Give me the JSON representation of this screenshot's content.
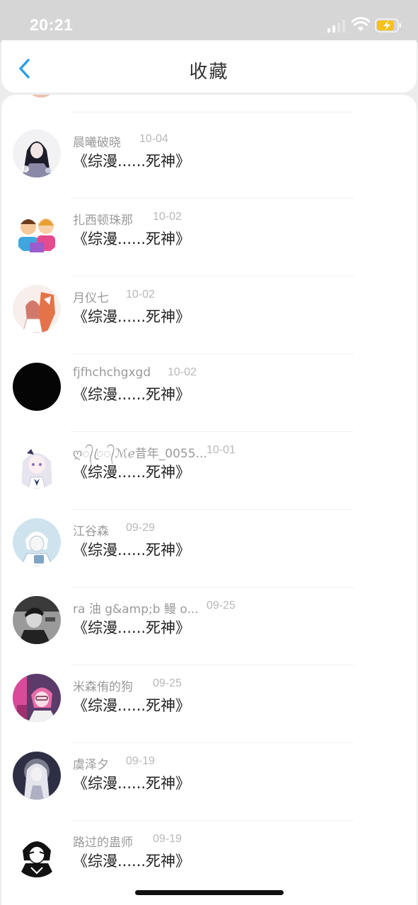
{
  "status_bar": {
    "time": "20:21",
    "signal_icon": "cellular-signal-icon",
    "wifi_icon": "wifi-icon",
    "battery_icon": "battery-charging-icon"
  },
  "header": {
    "title": "收藏",
    "back_icon": "chevron-left-icon"
  },
  "colors": {
    "accent": "#2b9fe6",
    "battery": "#f5c21b",
    "username": "#9a9a9a",
    "date": "#b8b8b8",
    "title": "#222222"
  },
  "favorites": [
    {
      "username": "晨曦破晓",
      "date": "10-04",
      "title": "《综漫......死神》",
      "avatar": "anime-dark-hair-avatar"
    },
    {
      "username": "扎西顿珠那",
      "date": "10-02",
      "title": "《综漫......死神》",
      "avatar": "cartoon-kids-avatar"
    },
    {
      "username": "月仪七",
      "date": "10-02",
      "title": "《综漫......死神》",
      "avatar": "fox-girl-avatar"
    },
    {
      "username": "fjfhchchgxgd",
      "date": "10-02",
      "title": "《综漫......死神》",
      "avatar": "black-avatar"
    },
    {
      "username": "ღ᭄ꦿ᭄ℳℯ昔年_0055...",
      "date": "10-01",
      "title": "《综漫......死神》",
      "avatar": "anime-white-hair-girl-avatar"
    },
    {
      "username": "江谷森",
      "date": "09-29",
      "title": "《综漫......死神》",
      "avatar": "anime-blue-sketch-avatar"
    },
    {
      "username": "ra 油 g&amp;b 鳗 o...",
      "date": "09-25",
      "title": "《综漫......死神》",
      "avatar": "monochrome-man-avatar"
    },
    {
      "username": "米森侑的狗",
      "date": "09-25",
      "title": "《综漫......死神》",
      "avatar": "anime-pink-hair-avatar"
    },
    {
      "username": "虞泽夕",
      "date": "09-19",
      "title": "《综漫......死神》",
      "avatar": "anime-silver-hair-avatar"
    },
    {
      "username": "路过的蛊师",
      "date": "09-19",
      "title": "《综漫......死神》",
      "avatar": "ink-sketch-boy-avatar"
    }
  ]
}
